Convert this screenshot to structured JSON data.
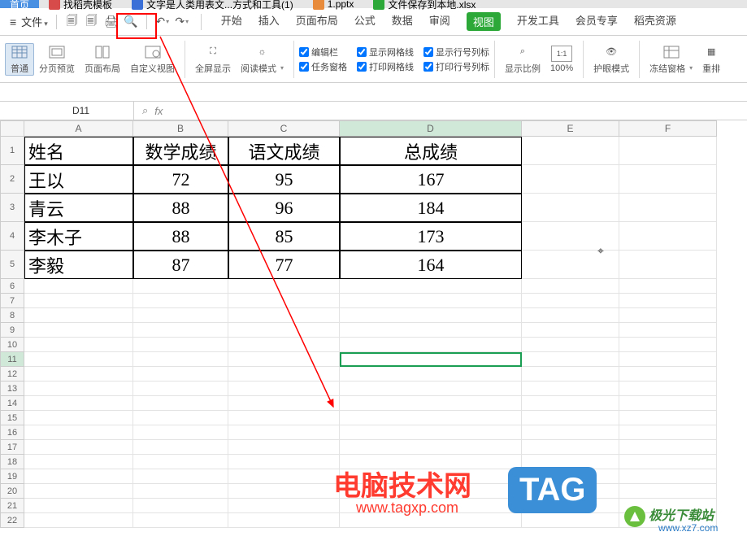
{
  "tabs": {
    "active": "首页",
    "items": [
      "找稻壳模板",
      "文字是人类用表文...方式和工具(1)",
      "1.pptx",
      "文件保存到本地.xlsx"
    ]
  },
  "file_menu": "文件",
  "menu": {
    "start": "开始",
    "insert": "插入",
    "page_layout": "页面布局",
    "formula": "公式",
    "data": "数据",
    "review": "审阅",
    "view": "视图",
    "dev": "开发工具",
    "member": "会员专享",
    "resource": "稻壳资源"
  },
  "ribbon": {
    "normal": "普通",
    "page_break": "分页预览",
    "page_layout": "页面布局",
    "custom_view": "自定义视图",
    "fullscreen": "全屏显示",
    "read_mode": "阅读模式",
    "edit_bar": "编辑栏",
    "task_pane": "任务窗格",
    "show_grid": "显示网格线",
    "print_grid": "打印网格线",
    "show_headings": "显示行号列标",
    "print_headings": "打印行号列标",
    "zoom": "显示比例",
    "zoom_val": "100%",
    "eye_protect": "护眼模式",
    "freeze": "冻结窗格",
    "rearrange": "重排"
  },
  "name_box": "D11",
  "fx": "fx",
  "columns": [
    "A",
    "B",
    "C",
    "D",
    "E",
    "F"
  ],
  "data": {
    "headers": [
      "姓名",
      "数学成绩",
      "语文成绩",
      "总成绩"
    ],
    "rows": [
      {
        "name": "王以",
        "math": "72",
        "chinese": "95",
        "total": "167"
      },
      {
        "name": "青云",
        "math": "88",
        "chinese": "96",
        "total": "184"
      },
      {
        "name": "李木子",
        "math": "88",
        "chinese": "85",
        "total": "173"
      },
      {
        "name": "李毅",
        "math": "87",
        "chinese": "77",
        "total": "164"
      }
    ]
  },
  "chart_data": {
    "type": "table",
    "title": "",
    "columns": [
      "姓名",
      "数学成绩",
      "语文成绩",
      "总成绩"
    ],
    "rows": [
      [
        "王以",
        72,
        95,
        167
      ],
      [
        "青云",
        88,
        96,
        184
      ],
      [
        "李木子",
        88,
        85,
        173
      ],
      [
        "李毅",
        87,
        77,
        164
      ]
    ]
  },
  "selected_cell": "D11",
  "watermarks": {
    "wm1": "电脑技术网",
    "wm1_sub": "www.tagxp.com",
    "tag": "TAG",
    "wm2": "极光下载站",
    "wm2_sub": "www.xz7.com"
  }
}
